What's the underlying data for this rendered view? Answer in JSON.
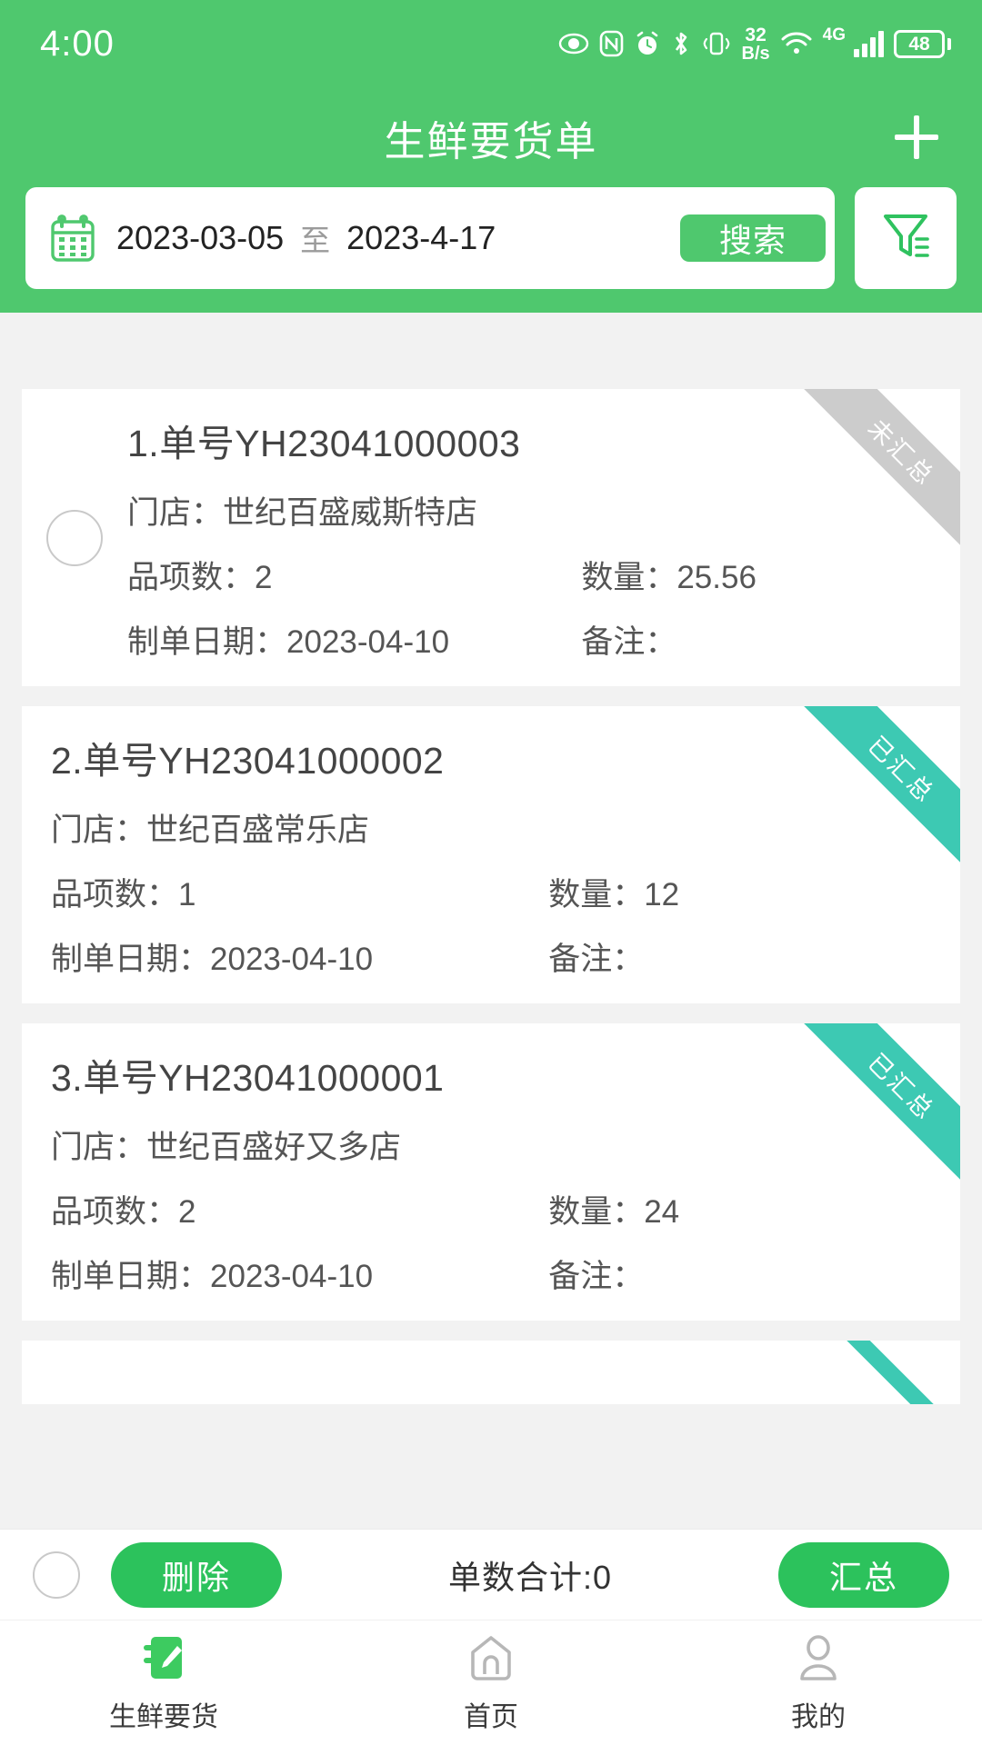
{
  "statusbar": {
    "time": "4:00",
    "network_speed_value": "32",
    "network_speed_unit": "B/s",
    "signal_gen": "4G",
    "battery_percent": "48",
    "icons": [
      "eye-comfort-icon",
      "nfc-icon",
      "alarm-icon",
      "bluetooth-icon",
      "vibrate-icon",
      "wifi-icon",
      "cellular-signal-icon",
      "battery-icon"
    ]
  },
  "header": {
    "title": "生鲜要货单",
    "add_label": "+"
  },
  "search": {
    "calendar_icon": "calendar-icon",
    "date_start": "2023-03-05",
    "date_separator": "至",
    "date_end": "2023-4-17",
    "search_label": "搜索",
    "filter_icon": "filter-icon"
  },
  "colors": {
    "header_green": "#4FC86E",
    "button_green": "#2CC25C",
    "ribbon_teal": "#3DC9B3",
    "ribbon_gray": "#CCCCCC"
  },
  "labels": {
    "store": "门店：",
    "item_count": "品项数：",
    "quantity": "数量：",
    "order_date": "制单日期：",
    "remark": "备注："
  },
  "orders": [
    {
      "index_title": "1.单号YH23041000003",
      "store": "世纪百盛威斯特店",
      "item_count": "2",
      "quantity": "25.56",
      "order_date": "2023-04-10",
      "remark": "",
      "status": "未汇总",
      "status_style": "gray",
      "selectable": true
    },
    {
      "index_title": "2.单号YH23041000002",
      "store": "世纪百盛常乐店",
      "item_count": "1",
      "quantity": "12",
      "order_date": "2023-04-10",
      "remark": "",
      "status": "已汇总",
      "status_style": "teal",
      "selectable": false
    },
    {
      "index_title": "3.单号YH23041000001",
      "store": "世纪百盛好又多店",
      "item_count": "2",
      "quantity": "24",
      "order_date": "2023-04-10",
      "remark": "",
      "status": "已汇总",
      "status_style": "teal",
      "selectable": false
    }
  ],
  "action_bar": {
    "delete_label": "删除",
    "total_label": "单数合计:0",
    "summarize_label": "汇总"
  },
  "nav": {
    "items": [
      {
        "label": "生鲜要货",
        "icon": "notebook-pencil-icon",
        "active": true
      },
      {
        "label": "首页",
        "icon": "home-icon",
        "active": false
      },
      {
        "label": "我的",
        "icon": "person-icon",
        "active": false
      }
    ]
  }
}
